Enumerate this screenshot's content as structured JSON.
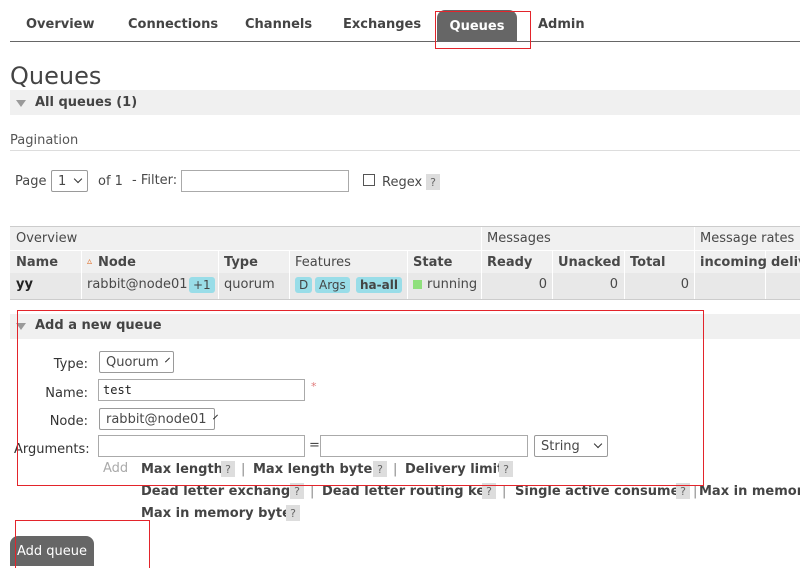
{
  "nav": {
    "tabs": [
      {
        "label": "Overview"
      },
      {
        "label": "Connections"
      },
      {
        "label": "Channels"
      },
      {
        "label": "Exchanges"
      },
      {
        "label": "Queues"
      },
      {
        "label": "Admin"
      }
    ],
    "active_tab": "Queues"
  },
  "page_title": "Queues",
  "all_queues": {
    "title": "All queues (1)"
  },
  "pagination": {
    "label": "Pagination",
    "page_label": "Page",
    "page_value": "1",
    "of_label": "of 1",
    "filter_label": "- Filter:",
    "filter_value": "",
    "regex_label": "Regex",
    "regex_checked": false,
    "help": "?"
  },
  "table": {
    "group_headers": [
      "Overview",
      "Messages",
      "Message rates"
    ],
    "columns": [
      "Name",
      "Node",
      "Type",
      "Features",
      "State",
      "Ready",
      "Unacked",
      "Total",
      "incoming",
      "deliv"
    ],
    "sort_indicator": "▵",
    "rows": [
      {
        "name": "yy",
        "node": "rabbit@node01",
        "node_extra": "+1",
        "type": "quorum",
        "features": [
          "D",
          "Args",
          "ha-all"
        ],
        "state": "running",
        "state_color": "#8fe07c",
        "ready": "0",
        "unacked": "0",
        "total": "0"
      }
    ]
  },
  "add_queue": {
    "title": "Add a new queue",
    "type_label": "Type:",
    "type_value": "Quorum",
    "name_label": "Name:",
    "name_value": "test",
    "required_mark": "*",
    "node_label": "Node:",
    "node_value": "rabbit@node01",
    "arguments_label": "Arguments:",
    "equals": "=",
    "arg_type_value": "String",
    "add_label": "Add",
    "separator": "|",
    "help": "?",
    "arg_links": [
      "Max length",
      "Max length bytes",
      "Delivery limit",
      "Dead letter exchange",
      "Dead letter routing key",
      "Single active consumer",
      "Max in memory",
      "Max in memory bytes"
    ],
    "submit_label": "Add queue"
  },
  "colors": {
    "accent": "#666666",
    "highlight": "#e3242b",
    "badge": "#99dde8",
    "running": "#8fe07c"
  }
}
